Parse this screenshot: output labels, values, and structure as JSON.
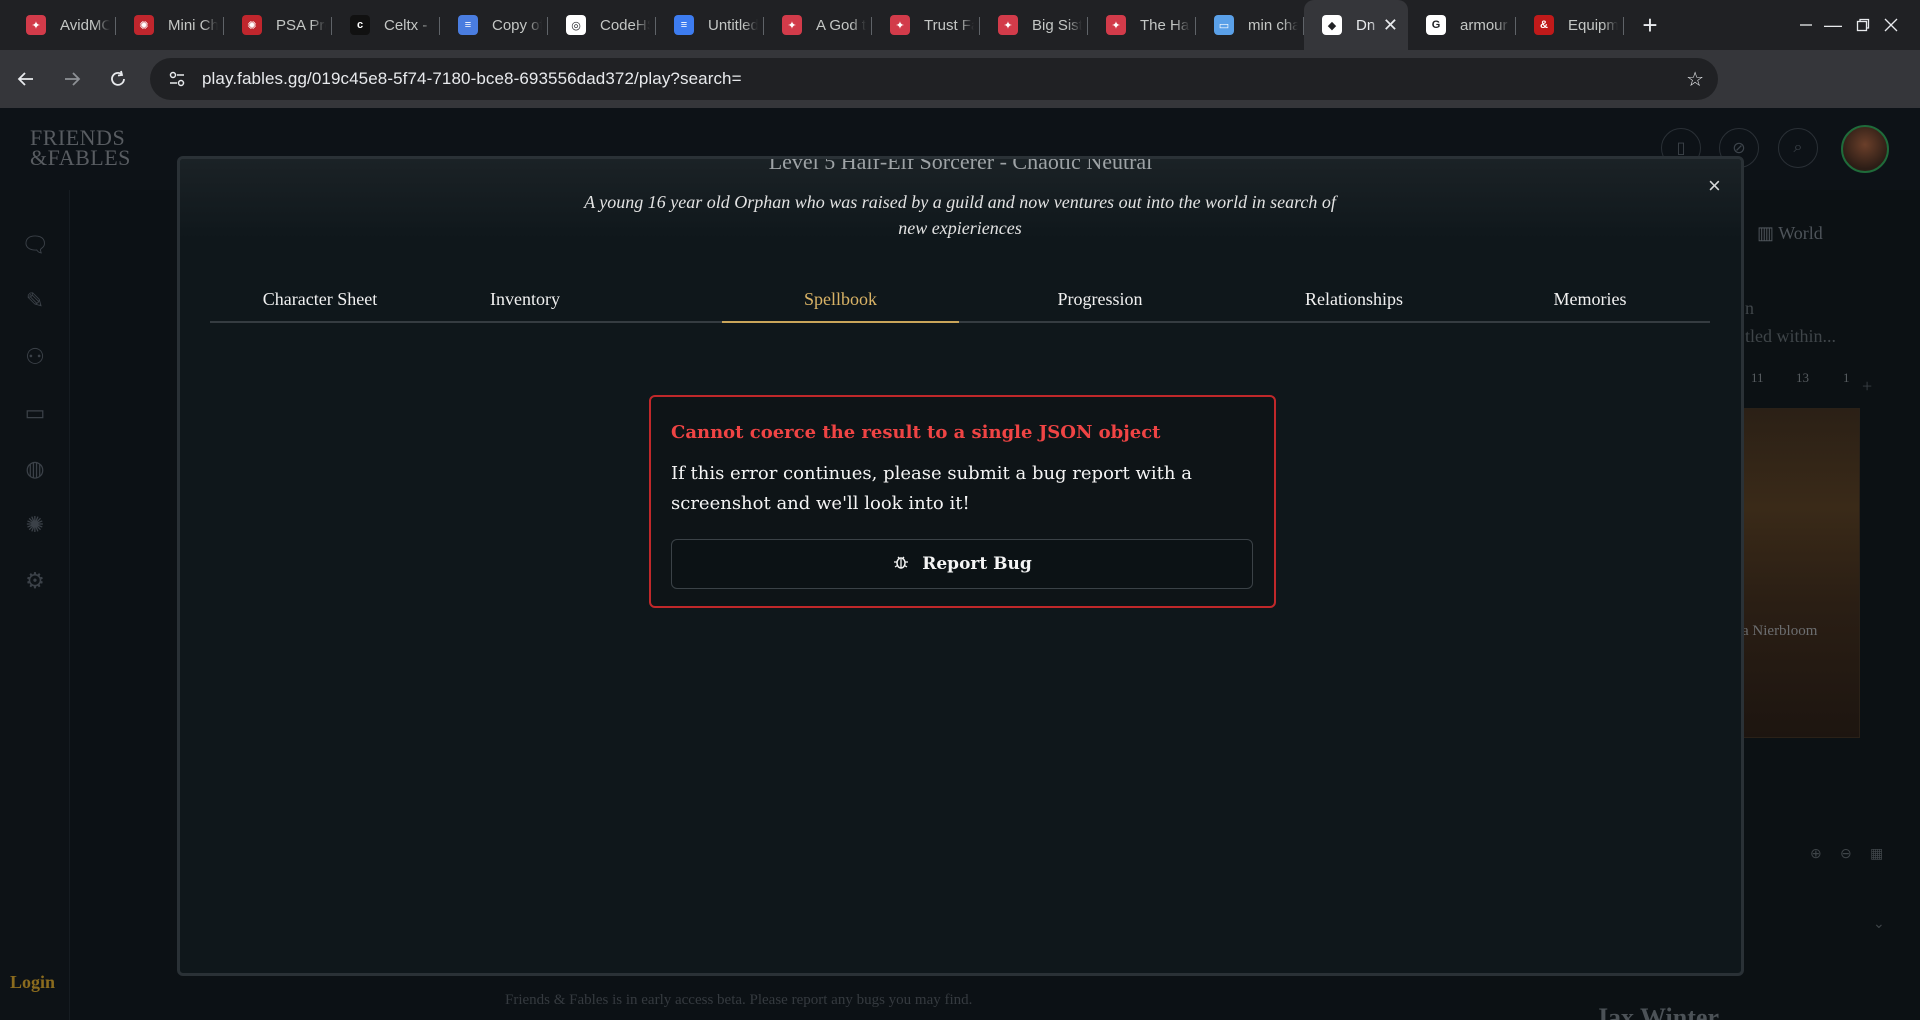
{
  "browser": {
    "tabs": [
      {
        "title": "AvidMC",
        "fav_color": "#d23b4a",
        "fav": "✦"
      },
      {
        "title": "Mini Ch",
        "fav_color": "#c0262d",
        "fav": "✺"
      },
      {
        "title": "PSA Pro",
        "fav_color": "#c0262d",
        "fav": "✺"
      },
      {
        "title": "Celtx - ",
        "fav_color": "#111111",
        "fav": "c"
      },
      {
        "title": "Copy of",
        "fav_color": "#4a7de0",
        "fav": "≡"
      },
      {
        "title": "CodeHS",
        "fav_color": "#ffffff",
        "fav": "◎"
      },
      {
        "title": "Untitled",
        "fav_color": "#3d7cf0",
        "fav": "≡"
      },
      {
        "title": "A God t",
        "fav_color": "#d23b4a",
        "fav": "✦"
      },
      {
        "title": "Trust Fa",
        "fav_color": "#d23b4a",
        "fav": "✦"
      },
      {
        "title": "Big Sist",
        "fav_color": "#d23b4a",
        "fav": "✦"
      },
      {
        "title": "The Hal",
        "fav_color": "#d23b4a",
        "fav": "✦"
      },
      {
        "title": "min cha",
        "fav_color": "#5aa0e8",
        "fav": "▭"
      },
      {
        "title": "Dn",
        "fav_color": "#ffffff",
        "fav": "◆",
        "active": true
      },
      {
        "title": "armour",
        "fav_color": "#ffffff",
        "fav": "G"
      },
      {
        "title": "Equipm",
        "fav_color": "#c01a1a",
        "fav": "&"
      }
    ],
    "new_tab": "+",
    "url": "play.fables.gg/019c45e8-5f74-7180-bce8-693556dad372/play?search="
  },
  "app": {
    "logo_line1": "FRIENDS",
    "logo_line2": "&FABLES",
    "login": "Login",
    "world_tab": "World",
    "faded_right_1": "n",
    "faded_right_2": "tled within...",
    "map_numbers": [
      "11",
      "13",
      "1"
    ],
    "map_label": "a Nierbloom",
    "footer_note": "Friends & Fables is in early access beta. Please report any bugs you may find.",
    "character_name_bottom": "Jax Winter"
  },
  "modal": {
    "character_level": "Level 5 Half-Elf Sorcerer - Chaotic Neutral",
    "description": "A young 16 year old Orphan who was raised by a guild and now ventures out into the world in search of new expieriences",
    "close": "×",
    "tabs": [
      {
        "label": "Character Sheet"
      },
      {
        "label": "Inventory"
      },
      {
        "label": "Spellbook",
        "active": true
      },
      {
        "label": "Progression"
      },
      {
        "label": "Relationships"
      },
      {
        "label": "Memories"
      }
    ],
    "error": {
      "title": "Cannot coerce the result to a single JSON object",
      "message": "If this error continues, please submit a bug report with a screenshot and we'll look into it!",
      "button": "Report Bug"
    }
  },
  "colors": {
    "accent_gold": "#d9b366",
    "error_red": "#ef4444"
  }
}
